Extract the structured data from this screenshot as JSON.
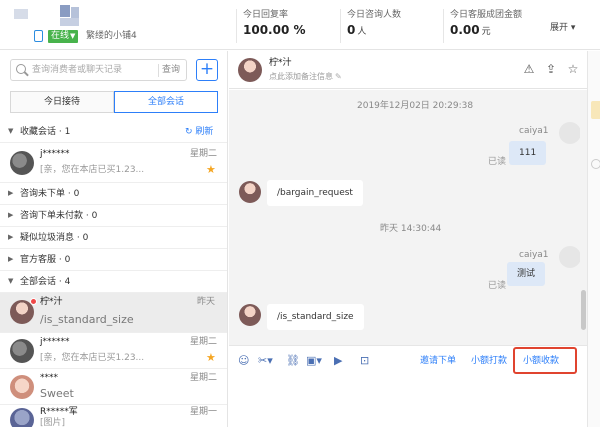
{
  "header": {
    "status_label": "在线",
    "shop_name": "繁缕的小铺4",
    "stats": [
      {
        "label": "今日回复率",
        "value": "100.00",
        "unit": "%"
      },
      {
        "label": "今日咨询人数",
        "value": "0",
        "unit": "人"
      },
      {
        "label": "今日客服成团金额",
        "value": "0.00",
        "unit": "元"
      }
    ],
    "expand_label": "展开"
  },
  "sidebar": {
    "search_placeholder": "查询消费者或聊天记录",
    "search_button": "查询",
    "tabs": [
      "今日接待",
      "全部会话"
    ],
    "active_tab": "全部会话",
    "groups": {
      "favorites": "收藏会话 · 1",
      "refresh": "刷新",
      "not_ordered": "咨询未下单 · 0",
      "unpaid": "咨询下单未付款 · 0",
      "spam": "疑似垃圾消息 · 0",
      "official": "官方客服 · 0",
      "all": "全部会话 · 4"
    },
    "fav_conversation": {
      "name": "j******",
      "day": "星期二",
      "message": "[亲，您在本店已买1.23..."
    },
    "conversations": [
      {
        "name": "柠*汁",
        "day": "昨天",
        "message": "/is_standard_size"
      },
      {
        "name": "j******",
        "day": "星期二",
        "message": "[亲，您在本店已买1.23..."
      },
      {
        "name": "****",
        "day": "星期二",
        "message": "Sweet"
      },
      {
        "name": "R*****军",
        "day": "星期一",
        "message": "[图片]"
      }
    ]
  },
  "chat": {
    "contact_name": "柠*汁",
    "contact_sub": "点此添加备注信息",
    "messages": {
      "ts1": "2019年12月02日 20:29:38",
      "out1_sender": "caiya1",
      "out1_text": "111",
      "out1_status": "已读",
      "in1_text": "/bargain_request",
      "ts2": "昨天 14:30:44",
      "out2_sender": "caiya1",
      "out2_text": "测试",
      "out2_status": "已读",
      "in2_text": "/is_standard_size"
    },
    "toolbar": {
      "icons": [
        "smile-icon",
        "scissors-icon",
        "link-icon",
        "image-icon",
        "video-icon",
        "coupon-icon"
      ],
      "invite_order": "邀请下单",
      "small_pay": "小额打款",
      "small_collect": "小额收款"
    }
  },
  "colors": {
    "accent": "#2d7ff9",
    "online": "#48b34c",
    "highlight": "#e0442f",
    "star": "#f5a623"
  }
}
